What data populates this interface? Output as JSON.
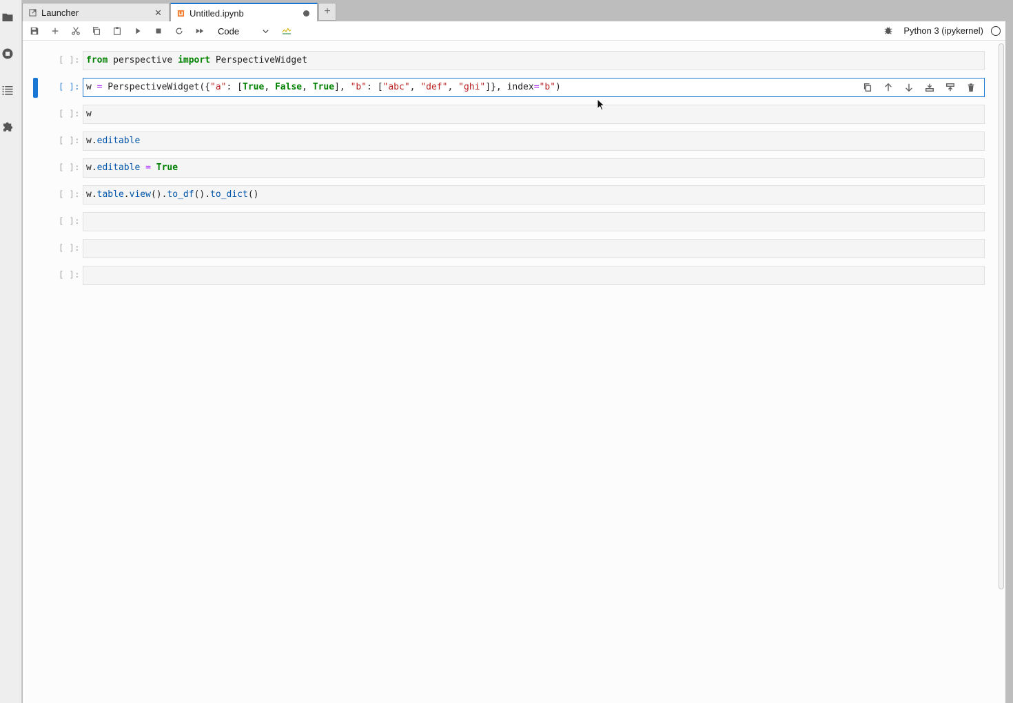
{
  "tabs": [
    {
      "label": "Launcher",
      "icon": "launcher-icon"
    },
    {
      "label": "Untitled.ipynb",
      "icon": "notebook-icon"
    }
  ],
  "toolbar": {
    "cell_type": "Code",
    "kernel": "Python 3 (ipykernel)"
  },
  "cells": [
    {
      "prompt": "[ ]:",
      "tokens": [
        [
          "kw",
          "from"
        ],
        [
          "t",
          " perspective "
        ],
        [
          "kw",
          "import"
        ],
        [
          "t",
          " PerspectiveWidget"
        ]
      ]
    },
    {
      "prompt": "[ ]:",
      "active": true,
      "tokens": [
        [
          "t",
          "w "
        ],
        [
          "op",
          "="
        ],
        [
          "t",
          " PerspectiveWidget({"
        ],
        [
          "str",
          "\"a\""
        ],
        [
          "t",
          ": ["
        ],
        [
          "kw",
          "True"
        ],
        [
          "t",
          ", "
        ],
        [
          "kw",
          "False"
        ],
        [
          "t",
          ", "
        ],
        [
          "kw",
          "True"
        ],
        [
          "t",
          "], "
        ],
        [
          "str",
          "\"b\""
        ],
        [
          "t",
          ": ["
        ],
        [
          "str",
          "\"abc\""
        ],
        [
          "t",
          ", "
        ],
        [
          "str",
          "\"def\""
        ],
        [
          "t",
          ", "
        ],
        [
          "str",
          "\"ghi\""
        ],
        [
          "t",
          "]}, index"
        ],
        [
          "op",
          "="
        ],
        [
          "str",
          "\"b\""
        ],
        [
          "t",
          ")"
        ]
      ]
    },
    {
      "prompt": "[ ]:",
      "tokens": [
        [
          "t",
          "w"
        ]
      ]
    },
    {
      "prompt": "[ ]:",
      "tokens": [
        [
          "t",
          "w."
        ],
        [
          "attr",
          "editable"
        ]
      ]
    },
    {
      "prompt": "[ ]:",
      "tokens": [
        [
          "t",
          "w."
        ],
        [
          "attr",
          "editable"
        ],
        [
          "t",
          " "
        ],
        [
          "op",
          "="
        ],
        [
          "t",
          " "
        ],
        [
          "kw",
          "True"
        ]
      ]
    },
    {
      "prompt": "[ ]:",
      "tokens": [
        [
          "t",
          "w."
        ],
        [
          "attr",
          "table"
        ],
        [
          "t",
          "."
        ],
        [
          "attr",
          "view"
        ],
        [
          "t",
          "()."
        ],
        [
          "attr",
          "to_df"
        ],
        [
          "t",
          "()."
        ],
        [
          "attr",
          "to_dict"
        ],
        [
          "t",
          "()"
        ]
      ]
    },
    {
      "prompt": "[ ]:",
      "tokens": []
    },
    {
      "prompt": "[ ]:",
      "tokens": []
    },
    {
      "prompt": "[ ]:",
      "tokens": []
    }
  ]
}
